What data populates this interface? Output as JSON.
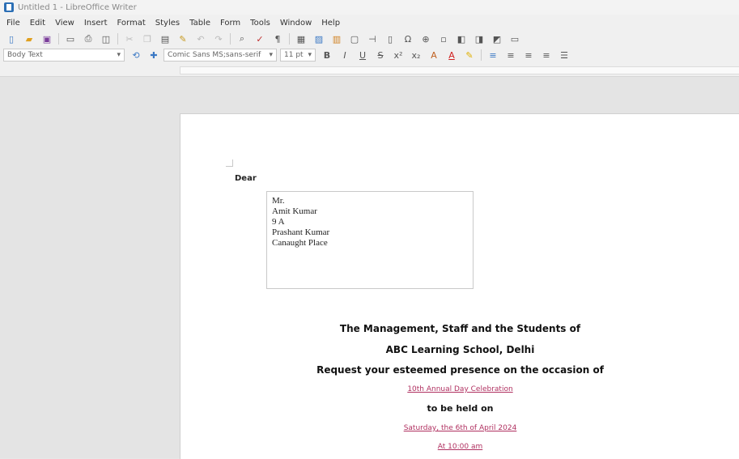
{
  "window": {
    "title": "Untitled 1 - LibreOffice Writer"
  },
  "menu": [
    "File",
    "Edit",
    "View",
    "Insert",
    "Format",
    "Styles",
    "Table",
    "Form",
    "Tools",
    "Window",
    "Help"
  ],
  "toolbar": {
    "paragraph_style": "Body Text",
    "font_name": "Comic Sans MS;sans-serif",
    "font_size": "11 pt"
  },
  "document": {
    "salutation": "Dear",
    "address_lines": [
      "Mr.",
      "Amit Kumar",
      "9 A",
      "Prashant Kumar",
      "Canaught Place"
    ],
    "invitation_lines": [
      {
        "text": "The Management, Staff and the Students of",
        "style": "big"
      },
      {
        "text": "ABC Learning School, Delhi",
        "style": "big"
      },
      {
        "text": "Request your esteemed presence on the occasion of",
        "style": "big"
      },
      {
        "text": "10th Annual Day Celebration",
        "style": "link"
      },
      {
        "text": "to be held on",
        "style": "mid"
      },
      {
        "text": "Saturday, the 6th of April 2024",
        "style": "link"
      },
      {
        "text": "At 10:00 am",
        "style": "link"
      }
    ]
  }
}
